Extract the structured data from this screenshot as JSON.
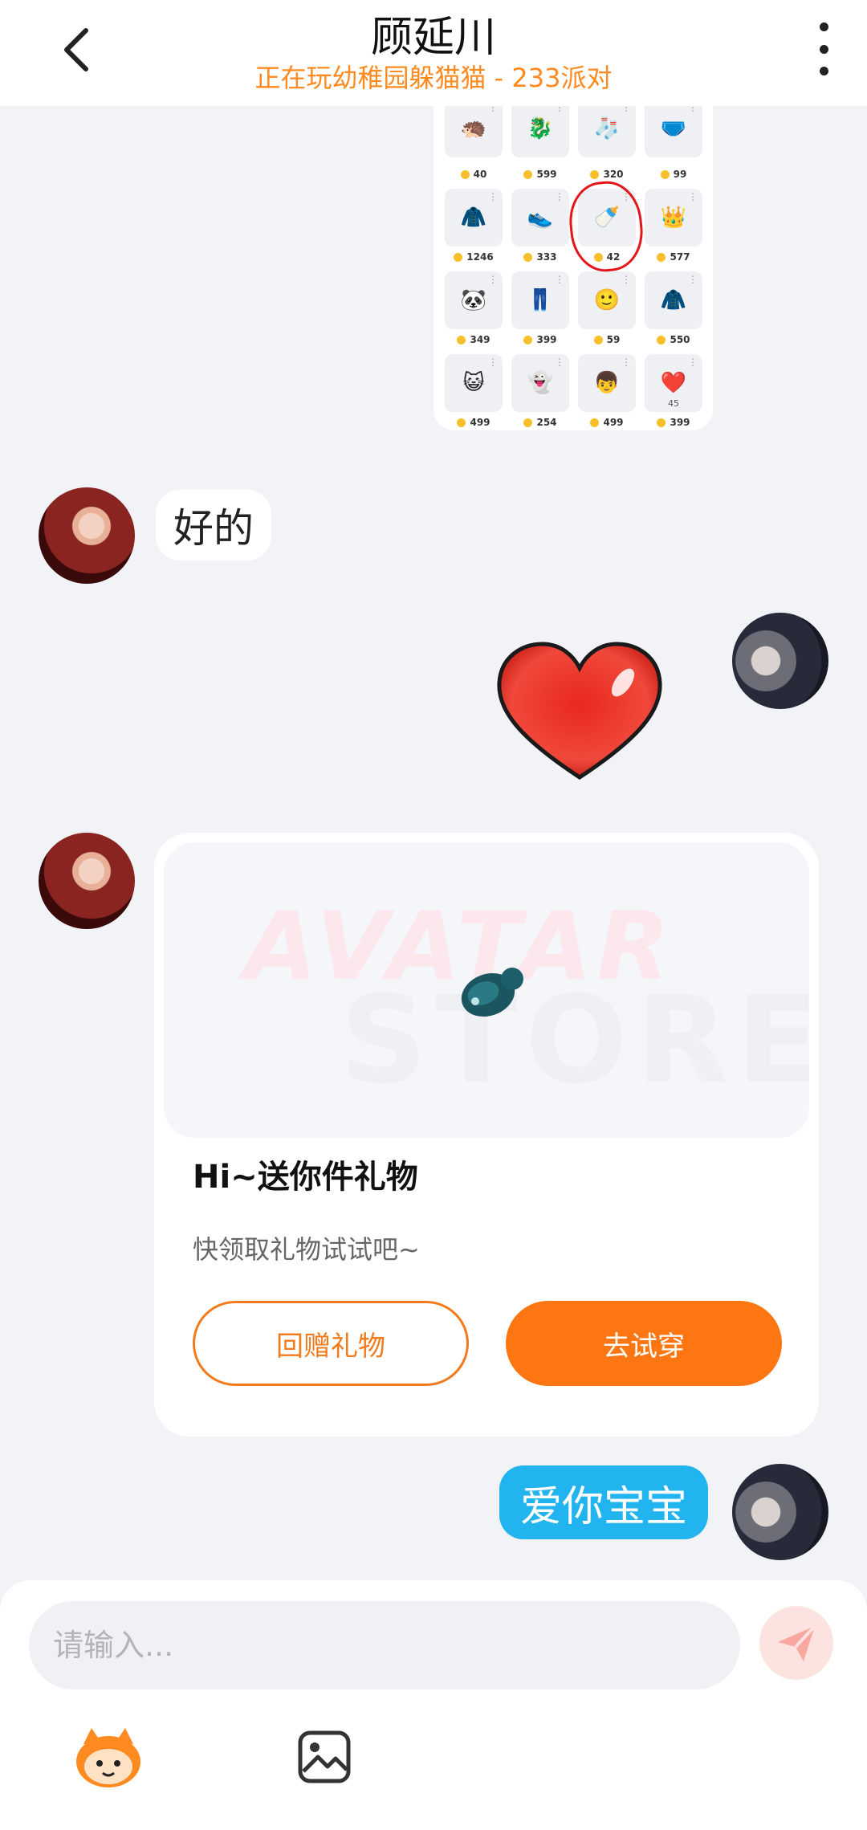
{
  "header": {
    "title": "顾延川",
    "subtitle": "正在玩幼稚园躲猫猫 - 233派对"
  },
  "store_screenshot": {
    "items": [
      {
        "icon": "🦔",
        "price": "40"
      },
      {
        "icon": "🐉",
        "price": "599"
      },
      {
        "icon": "🧦",
        "price": "320"
      },
      {
        "icon": "🩲",
        "price": "99"
      },
      {
        "icon": "🧥",
        "price": "1246"
      },
      {
        "icon": "👟",
        "price": "333"
      },
      {
        "icon": "🍼",
        "price": "42"
      },
      {
        "icon": "👑",
        "price": "577"
      },
      {
        "icon": "🐼",
        "price": "349"
      },
      {
        "icon": "👖",
        "price": "399"
      },
      {
        "icon": "🙂",
        "price": "59"
      },
      {
        "icon": "🧥",
        "price": "550"
      },
      {
        "icon": "😺",
        "price": "499"
      },
      {
        "icon": "👻",
        "price": "254"
      },
      {
        "icon": "👦",
        "price": "499"
      },
      {
        "icon": "❤️",
        "badge": "45",
        "price": "399"
      }
    ]
  },
  "messages": {
    "reply_text": "好的",
    "love_text": "爱你宝宝"
  },
  "gift_card": {
    "watermark_top": "AVATAR",
    "watermark_bottom": "STORE",
    "title": "Hi~送你件礼物",
    "subtitle": "快领取礼物试试吧~",
    "return_button": "回赠礼物",
    "try_button": "去试穿"
  },
  "input": {
    "placeholder": "请输入..."
  },
  "colors": {
    "accent_orange": "#fd7612",
    "subtitle_orange": "#ff8a1f",
    "bubble_blue": "#22b4ee",
    "background": "#f1f3f7"
  },
  "icons": {
    "back": "chevron-left-icon",
    "more": "more-vertical-icon",
    "send": "send-icon",
    "mascot": "mascot-icon",
    "image": "image-icon"
  }
}
